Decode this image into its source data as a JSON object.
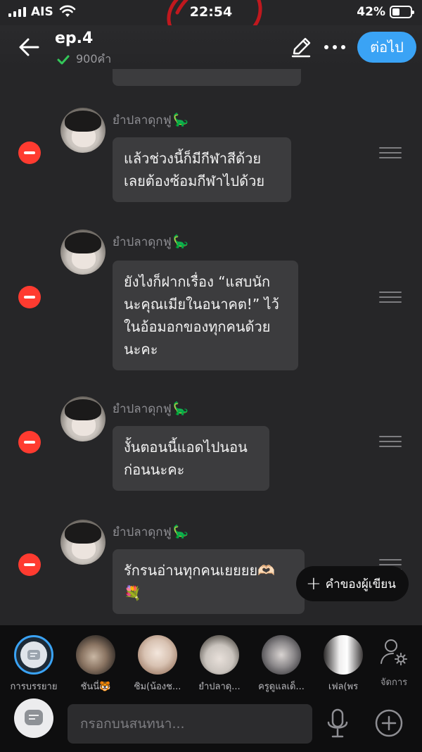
{
  "status_bar": {
    "carrier": "AIS",
    "time": "22:54",
    "battery_percent": "42%",
    "battery_level": 0.42
  },
  "header": {
    "title": "ep.4",
    "word_count": "900คำ",
    "next_label": "ต่อไป"
  },
  "messages": [
    {
      "sender": "ยำปลาดุกฟู",
      "lines": [
        "แล้วช่วงนี้ก็มีกีฬาสีด้วย",
        "เลยต้องซ้อมกีฬาไปด้วย"
      ]
    },
    {
      "sender": "ยำปลาดุกฟู",
      "lines": [
        "ยังไงก็ฝากเรื่อง “แสบนัก",
        "นะคุณเมียในอนาคต!” ไว้",
        "ในอ้อมอกของทุกคนด้วย",
        "นะคะ"
      ]
    },
    {
      "sender": "ยำปลาดุกฟู",
      "lines": [
        "งั้นตอนนี้แอดไปนอน",
        "ก่อนนะคะ"
      ]
    },
    {
      "sender": "ยำปลาดุกฟู",
      "lines": [
        "รักรนอ่านทุกคนเยยยย🫶🏻",
        "💐"
      ]
    }
  ],
  "author_note_label": "คำของผู้เขียน",
  "characters": [
    {
      "label": "การบรรยาย"
    },
    {
      "label": "ชันนี่🐯"
    },
    {
      "label": "ซิม(น้องช..."
    },
    {
      "label": "ยำปลาดุ..."
    },
    {
      "label": "ครูดูแลเด็..."
    },
    {
      "label": "เฟล(พร"
    }
  ],
  "manage_label": "จัดการ",
  "input": {
    "placeholder": "กรอกบนสนทนา..."
  },
  "colors": {
    "accent": "#3aa3f5",
    "remove": "#ff3b30",
    "verified": "#34c759",
    "annotation": "#c0181e"
  },
  "icons": {
    "back": "arrow-left-icon",
    "verified": "check-icon",
    "edit": "pencil-icon",
    "more": "more-dots-icon",
    "remove": "minus-circle-icon",
    "drag": "drag-handle-icon",
    "add": "plus-icon",
    "manage": "user-settings-icon",
    "mic": "mic-icon",
    "add_circle": "plus-circle-icon"
  }
}
